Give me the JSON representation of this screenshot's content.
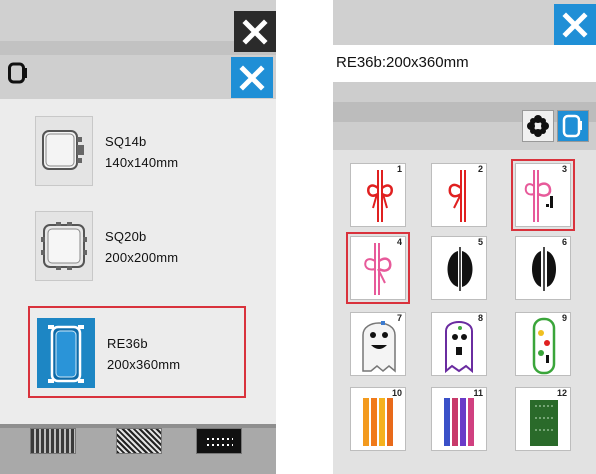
{
  "left_panel": {
    "close_label": "×",
    "hoops": [
      {
        "name": "SQ14b",
        "size": "140x140mm",
        "selected": false
      },
      {
        "name": "SQ20b",
        "size": "200x200mm",
        "selected": false
      },
      {
        "name": "RE36b",
        "size": "200x360mm",
        "selected": true
      }
    ],
    "bottom_tabs": [
      "pattern-tab-1",
      "pattern-tab-2",
      "pattern-tab-3"
    ]
  },
  "right_panel": {
    "title": "RE36b:200x360mm",
    "tools": [
      "flower-icon",
      "hoop-frame-icon"
    ],
    "patterns": [
      {
        "num": "1",
        "selected": false
      },
      {
        "num": "2",
        "selected": false
      },
      {
        "num": "3",
        "selected": true
      },
      {
        "num": "4",
        "selected": true
      },
      {
        "num": "5",
        "selected": false
      },
      {
        "num": "6",
        "selected": false
      },
      {
        "num": "7",
        "selected": false
      },
      {
        "num": "8",
        "selected": false
      },
      {
        "num": "9",
        "selected": false
      },
      {
        "num": "10",
        "selected": false
      },
      {
        "num": "11",
        "selected": false
      },
      {
        "num": "12",
        "selected": false
      }
    ]
  },
  "colors": {
    "accent_blue": "#1f8fd6",
    "selection_red": "#d9323c",
    "dark_button": "#2b2b2b"
  }
}
